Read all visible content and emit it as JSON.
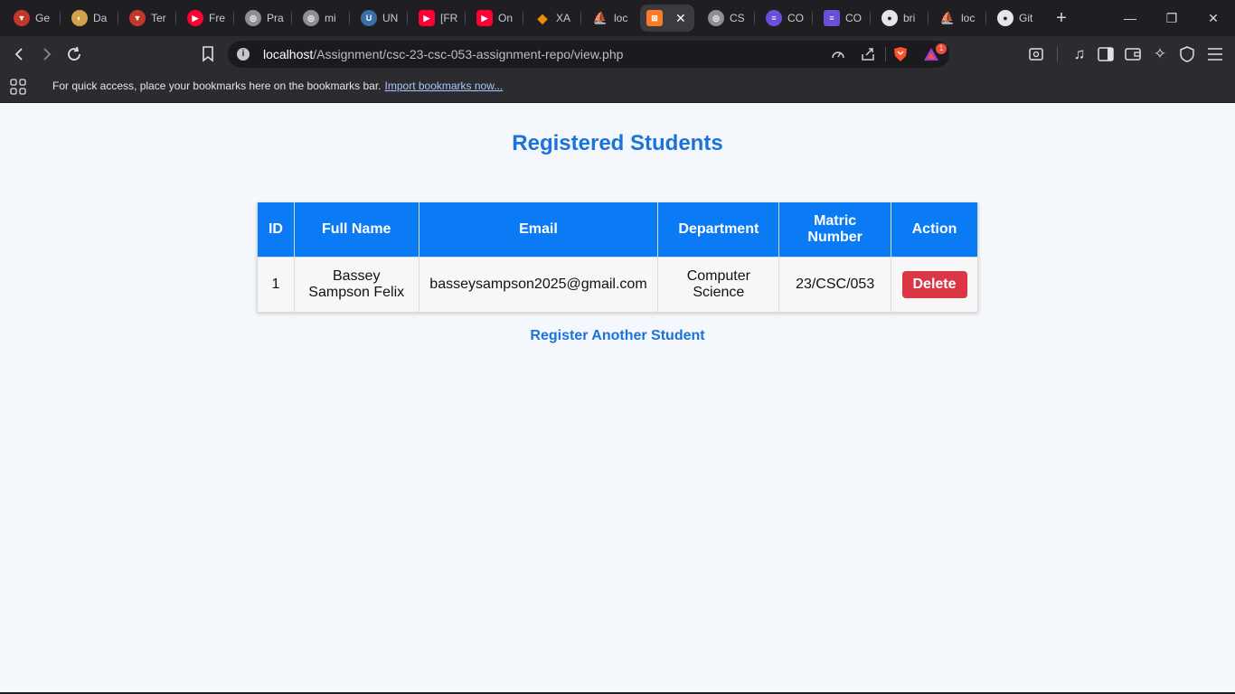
{
  "browser": {
    "tabs": [
      {
        "title": "Ge",
        "icon": "brave-icon",
        "color": "#c0392b"
      },
      {
        "title": "Da",
        "icon": "dashboard-icon",
        "color": "#d4a04a"
      },
      {
        "title": "Ter",
        "icon": "brave-icon",
        "color": "#c0392b"
      },
      {
        "title": "Fre",
        "icon": "youtube-icon",
        "color": "#ff0033"
      },
      {
        "title": "Pra",
        "icon": "globe-icon",
        "color": "#8e8e93"
      },
      {
        "title": "mi",
        "icon": "globe-icon",
        "color": "#8e8e93"
      },
      {
        "title": "UN",
        "icon": "university-icon",
        "color": "#3b6ea5"
      },
      {
        "title": "[FR",
        "icon": "youtube-icon",
        "color": "#ff0033"
      },
      {
        "title": "On",
        "icon": "youtube-icon",
        "color": "#ff0033"
      },
      {
        "title": "XA",
        "icon": "xampp-diamond-icon",
        "color": "#f08c00"
      },
      {
        "title": "loc",
        "icon": "phpmyadmin-icon",
        "color": "#e2a04c"
      },
      {
        "title": "",
        "icon": "xampp-icon",
        "color": "#fb7a24",
        "active": true
      },
      {
        "title": "CS",
        "icon": "globe-icon",
        "color": "#8e8e93"
      },
      {
        "title": "CO",
        "icon": "list-icon",
        "color": "#6b4fd8"
      },
      {
        "title": "CO",
        "icon": "list-icon",
        "color": "#6b4fd8"
      },
      {
        "title": "bri",
        "icon": "github-icon",
        "color": "#2b2b30"
      },
      {
        "title": "loc",
        "icon": "phpmyadmin-icon",
        "color": "#e2a04c"
      },
      {
        "title": "Git",
        "icon": "github-icon",
        "color": "#2b2b30"
      }
    ],
    "address": {
      "host": "localhost",
      "path": "/Assignment/csc-23-csc-053-assignment-repo/view.php"
    },
    "notification_count": "1",
    "bookmarks_bar": {
      "message": "For quick access, place your bookmarks here on the bookmarks bar.",
      "import_link": "Import bookmarks now..."
    }
  },
  "page": {
    "title": "Registered Students",
    "table": {
      "headers": [
        "ID",
        "Full Name",
        "Email",
        "Department",
        "Matric Number",
        "Action"
      ],
      "rows": [
        {
          "id": "1",
          "full_name": "Bassey Sampson Felix",
          "email": "basseysampson2025@gmail.com",
          "department": "Computer Science",
          "matric_number": "23/CSC/053",
          "action_label": "Delete"
        }
      ]
    },
    "register_link": "Register Another Student"
  },
  "colors": {
    "accent": "#1a73d9",
    "table_header": "#0a7bf5",
    "delete_button": "#dc3545"
  }
}
